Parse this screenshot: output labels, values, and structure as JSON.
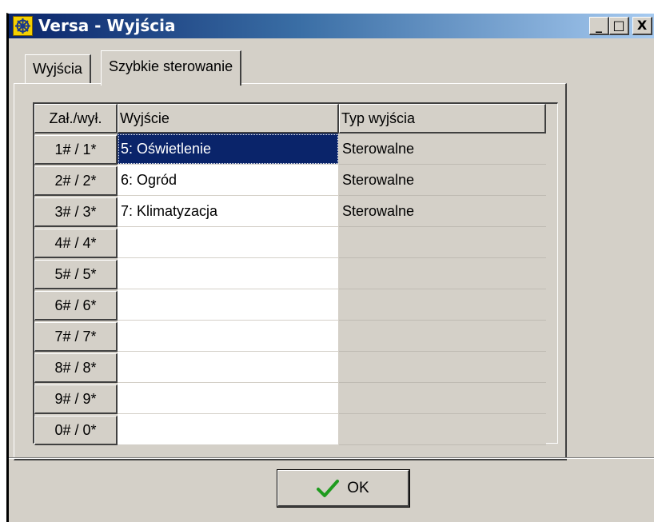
{
  "window": {
    "title": "Versa - Wyjścia",
    "controls": {
      "minimize": "_",
      "maximize": "□",
      "close": "X"
    }
  },
  "tabs": [
    {
      "label": "Wyjścia",
      "active": false
    },
    {
      "label": "Szybkie sterowanie",
      "active": true
    }
  ],
  "table": {
    "columns": [
      "Zał./wył.",
      "Wyjście",
      "Typ wyjścia"
    ],
    "rows": [
      {
        "key": "1# / 1*",
        "output": "5: Oświetlenie",
        "type": "Sterowalne",
        "selected": true
      },
      {
        "key": "2# / 2*",
        "output": "6: Ogród",
        "type": "Sterowalne"
      },
      {
        "key": "3# / 3*",
        "output": "7: Klimatyzacja",
        "type": "Sterowalne"
      },
      {
        "key": "4# / 4*",
        "output": "",
        "type": ""
      },
      {
        "key": "5# / 5*",
        "output": "",
        "type": ""
      },
      {
        "key": "6# / 6*",
        "output": "",
        "type": ""
      },
      {
        "key": "7# / 7*",
        "output": "",
        "type": ""
      },
      {
        "key": "8# / 8*",
        "output": "",
        "type": ""
      },
      {
        "key": "9# / 9*",
        "output": "",
        "type": ""
      },
      {
        "key": "0# / 0*",
        "output": "",
        "type": ""
      }
    ]
  },
  "ok_button": {
    "label": "OK",
    "icon": "checkmark-icon"
  },
  "colors": {
    "face": "#d4d0c8",
    "title_start": "#0a246a",
    "title_end": "#a6caf0",
    "selection": "#0a246a",
    "check": "#1e9b1e"
  }
}
